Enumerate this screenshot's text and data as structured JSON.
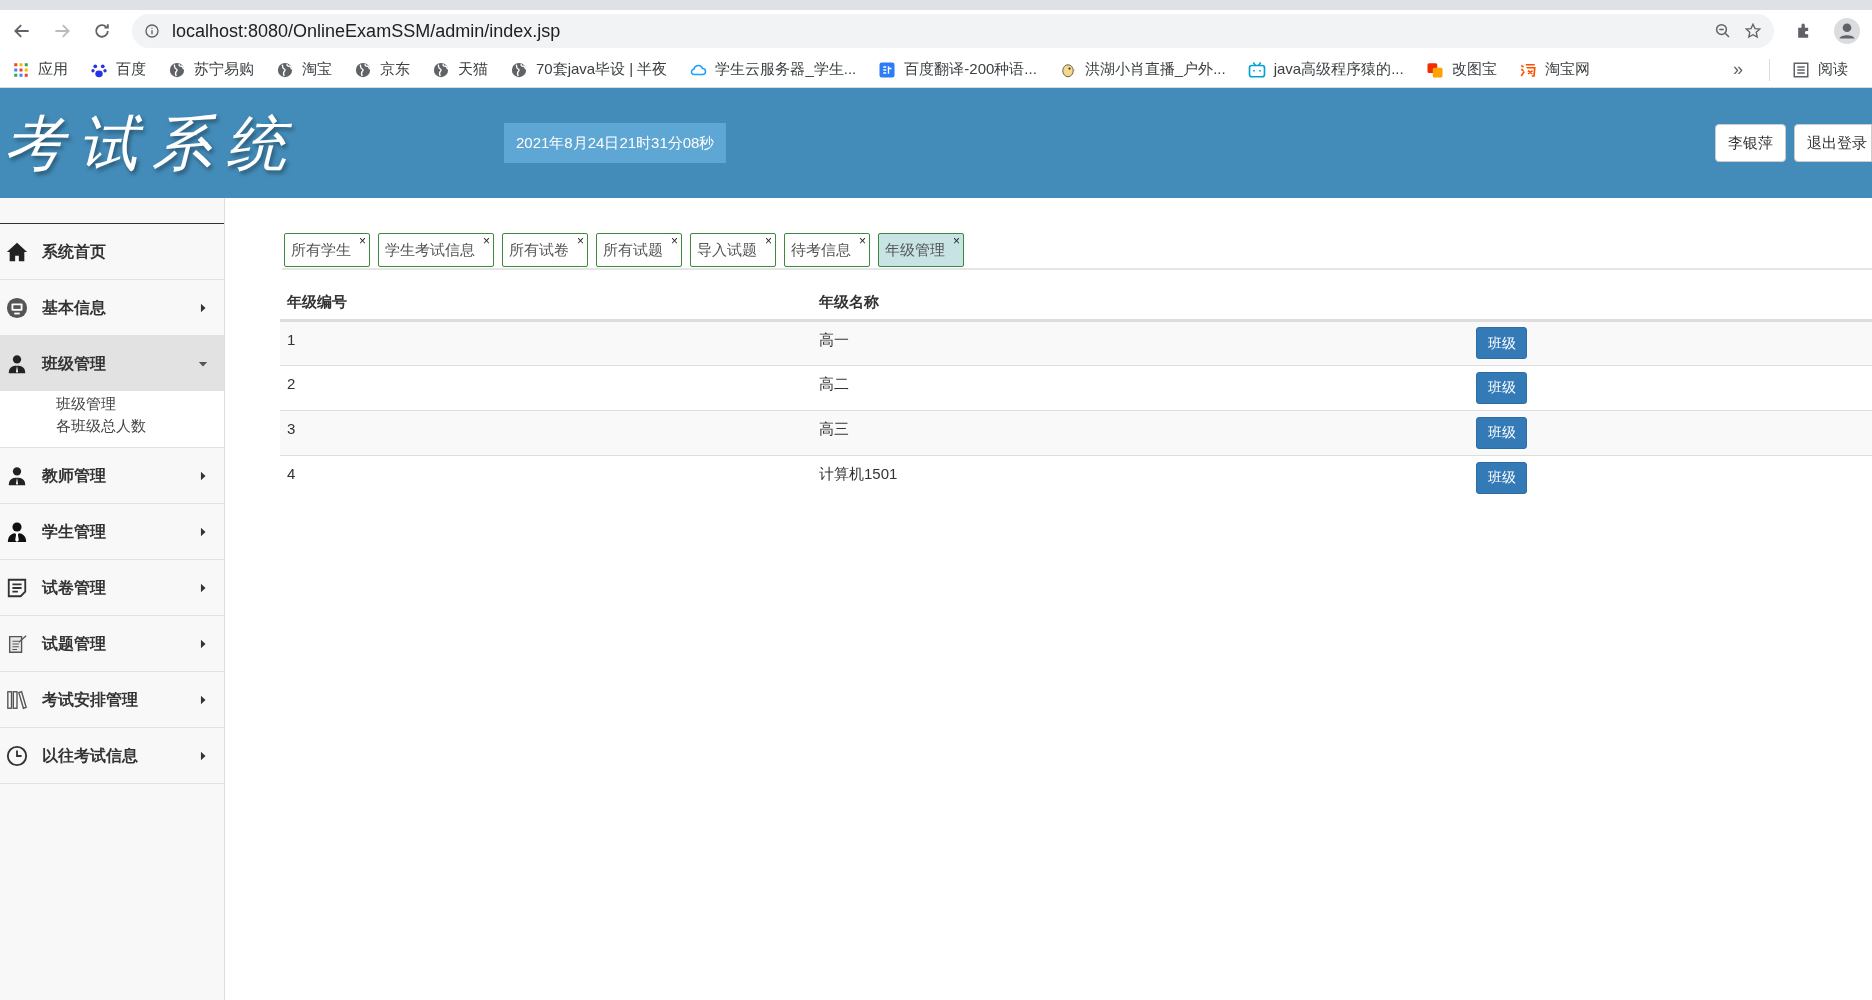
{
  "browser": {
    "url": "localhost:8080/OnlineExamSSM/admin/index.jsp",
    "bookmarks": [
      {
        "kind": "apps",
        "label": "应用"
      },
      {
        "kind": "paw",
        "label": "百度"
      },
      {
        "kind": "globe",
        "label": "苏宁易购"
      },
      {
        "kind": "globe",
        "label": "淘宝"
      },
      {
        "kind": "globe",
        "label": "京东"
      },
      {
        "kind": "globe",
        "label": "天猫"
      },
      {
        "kind": "globe",
        "label": "70套java毕设 | 半夜"
      },
      {
        "kind": "cloud",
        "label": "学生云服务器_学生..."
      },
      {
        "kind": "translate",
        "label": "百度翻译-200种语..."
      },
      {
        "kind": "bird",
        "label": "洪湖小肖直播_户外..."
      },
      {
        "kind": "tv",
        "label": "java高级程序猿的..."
      },
      {
        "kind": "squares",
        "label": "改图宝"
      },
      {
        "kind": "tao",
        "label": "淘宝网"
      }
    ],
    "more": "»",
    "reading_list": "阅读"
  },
  "header": {
    "title": "考试系统",
    "datetime": "2021年8月24日21时31分08秒",
    "user_button": "李银萍",
    "logout_button": "退出登录"
  },
  "sidebar": {
    "items": [
      {
        "kind": "home",
        "label": "系统首页",
        "expandable": false,
        "expanded": false
      },
      {
        "kind": "monitor",
        "label": "基本信息",
        "expandable": true,
        "expanded": false
      },
      {
        "kind": "person",
        "label": "班级管理",
        "expandable": true,
        "expanded": true,
        "children": [
          {
            "label": "班级管理"
          },
          {
            "label": "各班级总人数"
          }
        ]
      },
      {
        "kind": "person",
        "label": "教师管理",
        "expandable": true,
        "expanded": false
      },
      {
        "kind": "person-tie",
        "label": "学生管理",
        "expandable": true,
        "expanded": false
      },
      {
        "kind": "document",
        "label": "试卷管理",
        "expandable": true,
        "expanded": false
      },
      {
        "kind": "paper",
        "label": "试题管理",
        "expandable": true,
        "expanded": false
      },
      {
        "kind": "books",
        "label": "考试安排管理",
        "expandable": true,
        "expanded": false
      },
      {
        "kind": "clock",
        "label": "以往考试信息",
        "expandable": true,
        "expanded": false
      }
    ]
  },
  "tabs": [
    {
      "label": "所有学生",
      "close": "×",
      "selected": false
    },
    {
      "label": "学生考试信息",
      "close": "×",
      "selected": false
    },
    {
      "label": "所有试卷",
      "close": "×",
      "selected": false
    },
    {
      "label": "所有试题",
      "close": "×",
      "selected": false
    },
    {
      "label": "导入试题",
      "close": "×",
      "selected": false
    },
    {
      "label": "待考信息",
      "close": "×",
      "selected": false
    },
    {
      "label": "年级管理",
      "close": "×",
      "selected": true
    }
  ],
  "table": {
    "columns": [
      "年级编号",
      "年级名称"
    ],
    "rows": [
      {
        "id": "1",
        "name": "高一",
        "action": "班级"
      },
      {
        "id": "2",
        "name": "高二",
        "action": "班级"
      },
      {
        "id": "3",
        "name": "高三",
        "action": "班级"
      },
      {
        "id": "4",
        "name": "计算机1501",
        "action": "班级"
      }
    ]
  }
}
